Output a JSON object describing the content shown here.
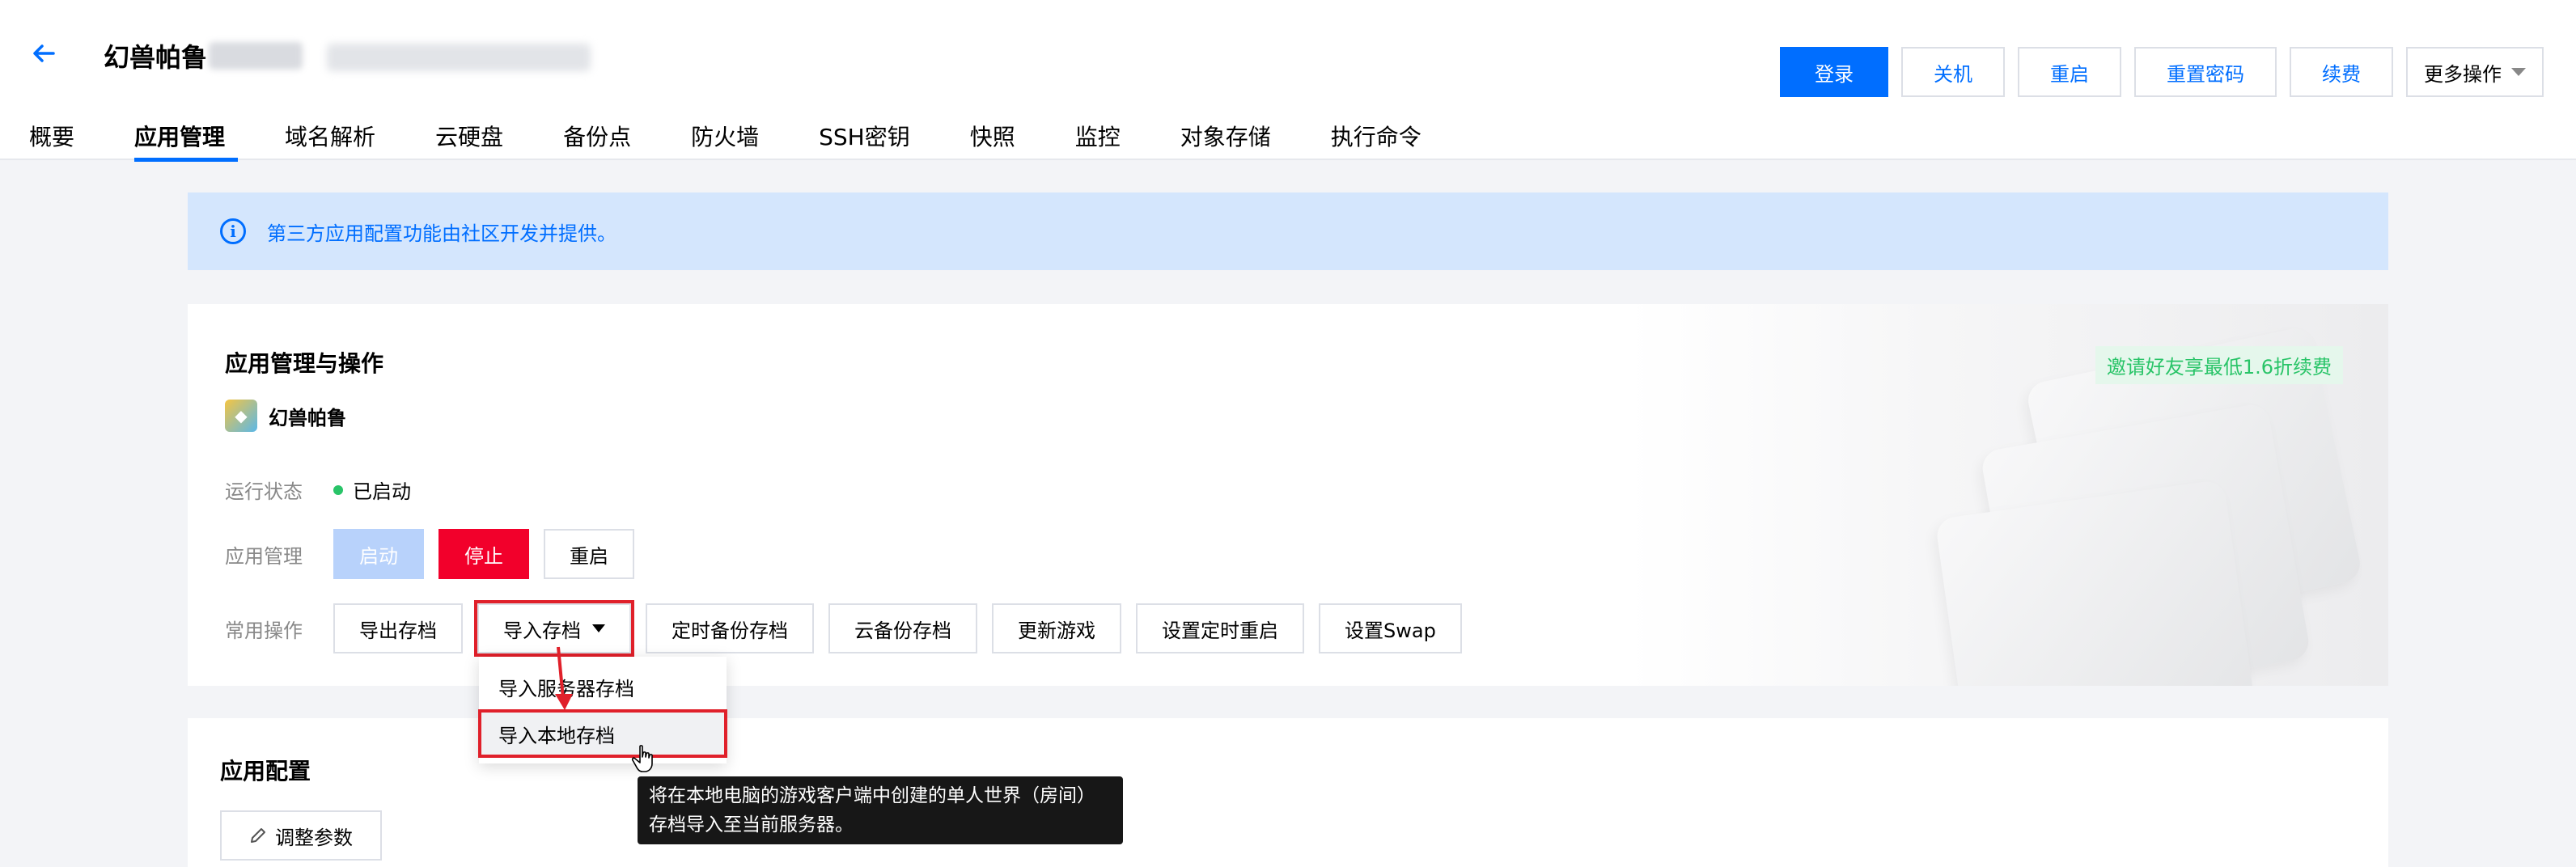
{
  "header": {
    "title": "幻兽帕鲁",
    "actions": {
      "login": "登录",
      "shutdown": "关机",
      "restart": "重启",
      "reset_password": "重置密码",
      "renew": "续费",
      "more": "更多操作"
    },
    "tabs": [
      "概要",
      "应用管理",
      "域名解析",
      "云硬盘",
      "备份点",
      "防火墙",
      "SSH密钥",
      "快照",
      "监控",
      "对象存储",
      "执行命令"
    ],
    "active_tab": "应用管理"
  },
  "banner": {
    "text": "第三方应用配置功能由社区开发并提供。"
  },
  "app_card": {
    "title": "应用管理与操作",
    "app_name": "幻兽帕鲁",
    "promo": "邀请好友享最低1.6折续费",
    "status": {
      "label": "运行状态",
      "value": "已启动"
    },
    "manage": {
      "label": "应用管理",
      "start": "启动",
      "stop": "停止",
      "restart": "重启"
    },
    "common": {
      "label": "常用操作",
      "export_save": "导出存档",
      "import_save": "导入存档",
      "scheduled_backup": "定时备份存档",
      "cloud_backup": "云备份存档",
      "update_game": "更新游戏",
      "scheduled_restart": "设置定时重启",
      "set_swap": "设置Swap"
    }
  },
  "dropdown": {
    "items": [
      "导入服务器存档",
      "导入本地存档"
    ]
  },
  "tooltip": {
    "text": "将在本地电脑的游戏客户端中创建的单人世界（房间）存档导入至当前服务器。"
  },
  "config_card": {
    "title": "应用配置",
    "adjust": "调整参数"
  },
  "colors": {
    "primary": "#006eff",
    "danger": "#f2002b",
    "success": "#29c468",
    "highlight": "#e0202a"
  }
}
